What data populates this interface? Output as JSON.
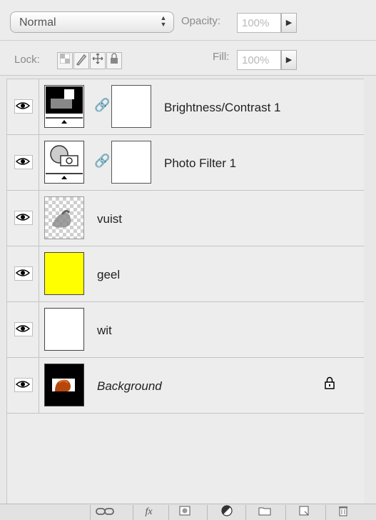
{
  "blend_mode": {
    "value": "Normal",
    "icon": "stepper-arrows-icon"
  },
  "opacity": {
    "label": "Opacity:",
    "value": "100%"
  },
  "lock": {
    "label": "Lock:"
  },
  "fill": {
    "label": "Fill:",
    "value": "100%"
  },
  "layers": [
    {
      "name": "Brightness/Contrast 1",
      "italic": false,
      "kind": "adjustment-brightness",
      "has_mask": true,
      "visible": true
    },
    {
      "name": "Photo Filter 1",
      "italic": false,
      "kind": "adjustment-photo-filter",
      "has_mask": true,
      "visible": true
    },
    {
      "name": "vuist",
      "italic": false,
      "kind": "transparent-image",
      "has_mask": false,
      "visible": true
    },
    {
      "name": "geel",
      "italic": false,
      "kind": "solid-fill",
      "fill_color": "#ffff00",
      "has_mask": false,
      "visible": true
    },
    {
      "name": "wit",
      "italic": false,
      "kind": "solid-fill",
      "fill_color": "#ffffff",
      "has_mask": false,
      "visible": true
    },
    {
      "name": "Background",
      "italic": true,
      "kind": "photo",
      "has_mask": false,
      "visible": true,
      "locked": true
    }
  ],
  "bottom_bar": {
    "buttons": [
      {
        "icon": "link-icon"
      },
      {
        "label": "fx",
        "icon": "fx-icon"
      },
      {
        "icon": "add-mask-icon"
      },
      {
        "icon": "adjustment-layer-icon"
      },
      {
        "icon": "folder-icon"
      },
      {
        "icon": "new-layer-icon"
      },
      {
        "icon": "trash-icon"
      }
    ]
  }
}
